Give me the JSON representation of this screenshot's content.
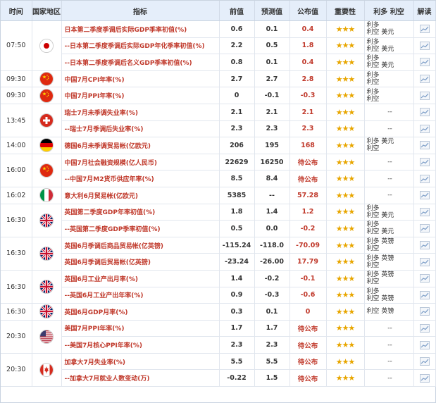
{
  "headers": [
    "时间",
    "国家地区",
    "指标",
    "前值",
    "预测值",
    "公布值",
    "重要性",
    "利多 利空",
    "解读"
  ],
  "stars": "★★★",
  "groups": [
    {
      "time": "07:50",
      "flag": "jp",
      "rows": [
        {
          "name": "日本第二季度季调后实际GDP季率初值(%)",
          "prev": "0.6",
          "fore": "0.1",
          "pub": "0.4",
          "eff": [
            "利多",
            "利空 美元"
          ]
        },
        {
          "name": "--日本第二季度季调后实际GDP年化季率初值(%)",
          "prev": "2.2",
          "fore": "0.5",
          "pub": "1.8",
          "eff": [
            "利多",
            "利空 美元"
          ]
        },
        {
          "name": "--日本第二季度季调后名义GDP季率初值(%)",
          "prev": "0.8",
          "fore": "0.1",
          "pub": "0.4",
          "eff": [
            "利多",
            "利空 美元"
          ]
        }
      ]
    },
    {
      "time": "09:30",
      "flag": "cn",
      "rows": [
        {
          "name": "中国7月CPI年率(%)",
          "prev": "2.7",
          "fore": "2.7",
          "pub": "2.8",
          "eff": [
            "利多",
            "利空"
          ]
        }
      ]
    },
    {
      "time": "09:30",
      "flag": "cn",
      "rows": [
        {
          "name": "中国7月PPI年率(%)",
          "prev": "0",
          "fore": "-0.1",
          "pub": "-0.3",
          "eff": [
            "利多",
            "利空"
          ]
        }
      ]
    },
    {
      "time": "13:45",
      "flag": "ch",
      "rows": [
        {
          "name": "瑞士7月未季调失业率(%)",
          "prev": "2.1",
          "fore": "2.1",
          "pub": "2.1",
          "eff": [
            "--"
          ]
        },
        {
          "name": "--瑞士7月季调后失业率(%)",
          "prev": "2.3",
          "fore": "2.3",
          "pub": "2.3",
          "eff": [
            "--"
          ]
        }
      ]
    },
    {
      "time": "14:00",
      "flag": "de",
      "rows": [
        {
          "name": "德国6月未季调贸易帐(亿欧元)",
          "prev": "206",
          "fore": "195",
          "pub": "168",
          "eff": [
            "利多 美元",
            "利空"
          ]
        }
      ]
    },
    {
      "time": "16:00",
      "flag": "cn",
      "rows": [
        {
          "name": "中国7月社会融资规模(亿人民币)",
          "prev": "22629",
          "fore": "16250",
          "pub": "待公布",
          "eff": [
            "--"
          ]
        },
        {
          "name": "--中国7月M2货币供应年率(%)",
          "prev": "8.5",
          "fore": "8.4",
          "pub": "待公布",
          "eff": [
            "--"
          ]
        }
      ]
    },
    {
      "time": "16:02",
      "flag": "it",
      "rows": [
        {
          "name": "意大利6月贸易帐(亿欧元)",
          "prev": "5385",
          "fore": "--",
          "pub": "57.28",
          "eff": [
            "--"
          ]
        }
      ]
    },
    {
      "time": "16:30",
      "flag": "gb",
      "rows": [
        {
          "name": "英国第二季度GDP年率初值(%)",
          "prev": "1.8",
          "fore": "1.4",
          "pub": "1.2",
          "eff": [
            "利多",
            "利空 美元"
          ]
        },
        {
          "name": "--英国第二季度GDP季率初值(%)",
          "prev": "0.5",
          "fore": "0.0",
          "pub": "-0.2",
          "eff": [
            "利多",
            "利空 美元"
          ]
        }
      ]
    },
    {
      "time": "16:30",
      "flag": "gb",
      "rows": [
        {
          "name": "英国6月季调后商品贸易帐(亿英镑)",
          "prev": "-115.24",
          "fore": "-118.0",
          "pub": "-70.09",
          "eff": [
            "利多 英镑",
            "利空"
          ]
        },
        {
          "name": "英国6月季调后贸易帐(亿英镑)",
          "prev": "-23.24",
          "fore": "-26.00",
          "pub": "17.79",
          "eff": [
            "利多 英镑",
            "利空"
          ]
        }
      ]
    },
    {
      "time": "16:30",
      "flag": "gb",
      "rows": [
        {
          "name": "英国6月工业产出月率(%)",
          "prev": "1.4",
          "fore": "-0.2",
          "pub": "-0.1",
          "eff": [
            "利多 英镑",
            "利空"
          ]
        },
        {
          "name": "--英国6月工业产出年率(%)",
          "prev": "0.9",
          "fore": "-0.3",
          "pub": "-0.6",
          "eff": [
            "利多",
            "利空 英镑"
          ]
        }
      ]
    },
    {
      "time": "16:30",
      "flag": "gb",
      "rows": [
        {
          "name": "英国6月GDP月率(%)",
          "prev": "0.3",
          "fore": "0.1",
          "pub": "0",
          "eff": [
            "利空 英镑"
          ]
        }
      ]
    },
    {
      "time": "20:30",
      "flag": "us",
      "rows": [
        {
          "name": "美国7月PPI年率(%)",
          "prev": "1.7",
          "fore": "1.7",
          "pub": "待公布",
          "eff": [
            "--"
          ]
        },
        {
          "name": "--美国7月核心PPI年率(%)",
          "prev": "2.3",
          "fore": "2.3",
          "pub": "待公布",
          "eff": [
            "--"
          ]
        }
      ]
    },
    {
      "time": "20:30",
      "flag": "ca",
      "rows": [
        {
          "name": "加拿大7月失业率(%)",
          "prev": "5.5",
          "fore": "5.5",
          "pub": "待公布",
          "eff": [
            "--"
          ]
        },
        {
          "name": "--加拿大7月就业人数变动(万)",
          "prev": "-0.22",
          "fore": "1.5",
          "pub": "待公布",
          "eff": [
            "--"
          ]
        }
      ]
    }
  ],
  "colors": {
    "header_bg": "#e5eefa",
    "indicator_red": "#c0392b",
    "star": "#e8a600"
  },
  "icons": {
    "explain": "chart-icon"
  }
}
